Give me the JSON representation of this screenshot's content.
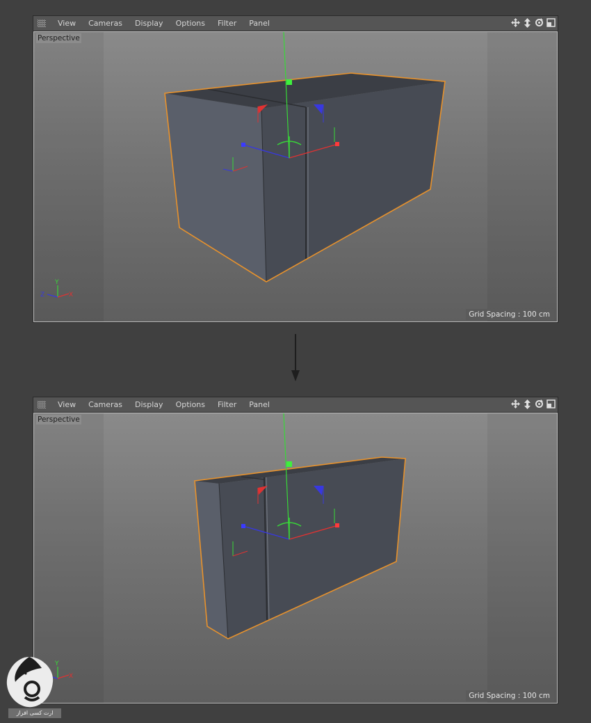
{
  "menu": [
    "View",
    "Cameras",
    "Display",
    "Options",
    "Filter",
    "Panel"
  ],
  "nav_icons": [
    "move-icon",
    "zoom-icon",
    "rotate-icon",
    "maximize-icon"
  ],
  "viewport_top": {
    "camera_label": "Perspective",
    "grid_spacing": "Grid Spacing : 100 cm",
    "axes": {
      "x": "X",
      "y": "Y",
      "z": "Z"
    }
  },
  "viewport_bottom": {
    "camera_label": "Perspective",
    "grid_spacing": "Grid Spacing : 100 cm",
    "axes": {
      "x": "X",
      "y": "Y",
      "z": "Z"
    }
  },
  "colors": {
    "selection": "#e8922c",
    "axis_x": "#e03232",
    "axis_y": "#38d838",
    "axis_z": "#3838e0"
  },
  "watermark_text": "ارت کسی افراز"
}
